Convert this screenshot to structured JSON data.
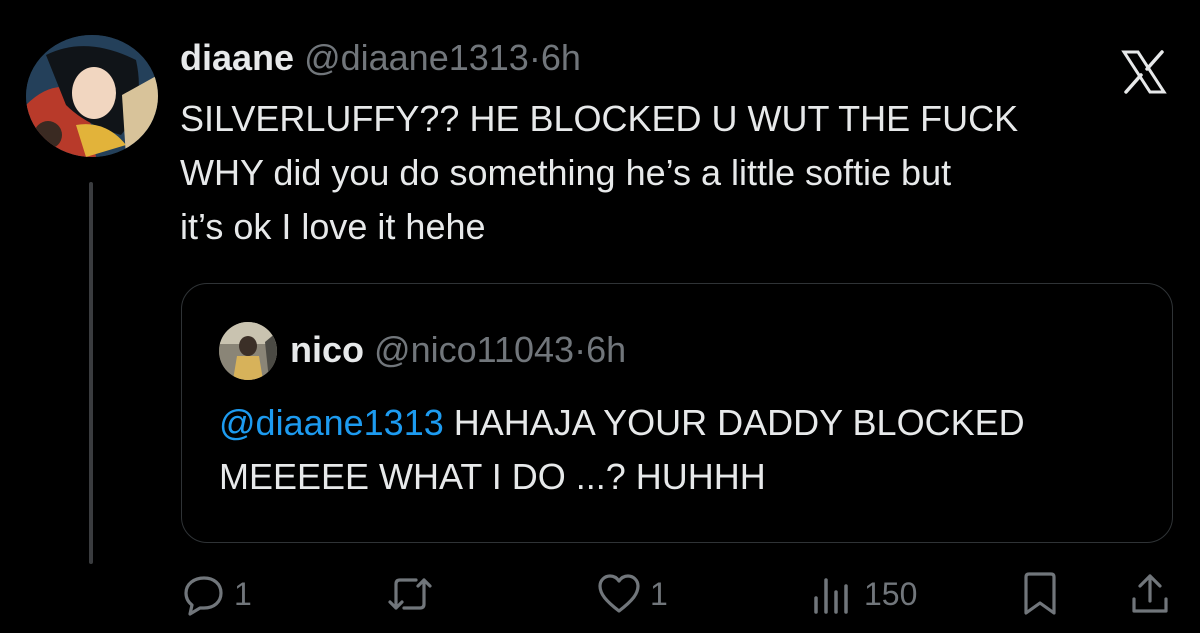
{
  "tweet": {
    "author_name": "diaane",
    "author_handle": "@diaane1313",
    "separator": "·",
    "time": "6h",
    "text": "SILVERLUFFY?? HE BLOCKED U WUT THE FUCK\nWHY did you do something he’s a little softie but\nit’s ok I love it hehe"
  },
  "quote": {
    "author_name": "nico",
    "author_handle": "@nico11043",
    "separator": "·",
    "time": "6h",
    "mention": "@diaane1313",
    "text": " HAHAJA YOUR DADDY BLOCKED MEEEEE WHAT I DO ...? HUHHH"
  },
  "actions": {
    "replies": "1",
    "likes": "1",
    "views": "150"
  },
  "icons": {
    "brand": "x-logo-icon",
    "reply": "reply-icon",
    "repost": "repost-icon",
    "like": "heart-icon",
    "views": "views-icon",
    "bookmark": "bookmark-icon",
    "share": "share-icon"
  },
  "colors": {
    "background": "#000000",
    "text": "#e7e9ea",
    "muted": "#71767b",
    "link": "#1d9bf0",
    "border": "#2f3336"
  }
}
